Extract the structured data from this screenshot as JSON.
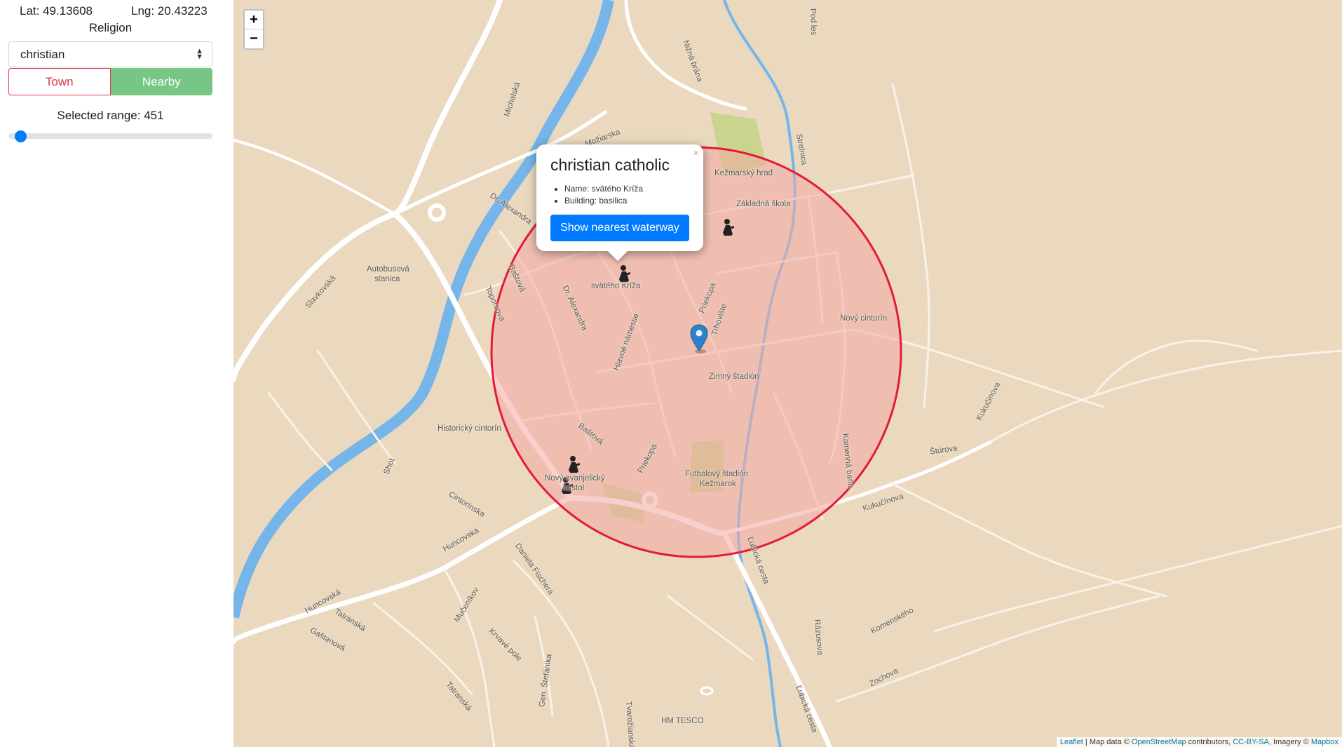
{
  "sidebar": {
    "lat_label": "Lat: 49.13608",
    "lng_label": "Lng: 20.43223",
    "title": "Religion",
    "select_value": "christian",
    "buttons": {
      "town": "Town",
      "nearby": "Nearby"
    },
    "range_label": "Selected range: 451",
    "range_fraction": 0.06
  },
  "map": {
    "zoom_in": "+",
    "zoom_out": "−",
    "labels": {
      "kezmarsky_hrad": "Kežmarský hrad",
      "zakladna_skola": "Základná škola",
      "novy_cintorin": "Nový cintorín",
      "zimny_stadion": "Zimný štadión",
      "futbalovy_stadion_1": "Futbalový štadión",
      "futbalovy_stadion_2": "Kežmarok",
      "historicky_cintorin": "Historický cintorín",
      "autobusova_1": "Autobusová",
      "autobusova_2": "stanica",
      "svateho_kriza": "svätého Kríža",
      "novy_kostol_1": "Nový evanjelický",
      "novy_kostol_2": "kostol",
      "hm_tesco": "HM TESCO"
    },
    "streets": {
      "michalska": "Michalská",
      "moziarska": "Možiarska",
      "dr_alexandra_1": "Dr. Alexandra",
      "dr_alexandra_2": "Dr. Alexandra",
      "slavkovska": "Slavkovská",
      "bastova_1": "Baštová",
      "bastova_2": "Baštová",
      "toporcova": "Toporcova",
      "hlavne_namestie": "Hlavné námestie",
      "priekopa_1": "Priekopa",
      "priekopa_2": "Priekopa",
      "trhoviste": "Trhovište",
      "nizna_brana": "Nižná brána",
      "strelnica": "Strelnica",
      "pod_les": "Pod les",
      "kamenna_bana": "Kamenná baňa",
      "sturova": "Štúrova",
      "kukucinova_1": "Kukučínova",
      "kukucinova_2": "Kukučínova",
      "lubicka_cesta_1": "Ľubická cesta",
      "lubicka_cesta_2": "Ľubická cesta",
      "razusova": "Rázusova",
      "komenskeho": "Komenského",
      "zochova": "Zochova",
      "cintorinska": "Cintorínska",
      "shot": "Shot",
      "huncovska_1": "Huncovská",
      "huncovska_2": "Huncovská",
      "tatranska_1": "Tatranská",
      "tatranska_2": "Tatranská",
      "gastanova": "Gaštanová",
      "mucenikov": "Mučeníkov",
      "krvave_pole": "Krvavé pole",
      "daniela_fischera": "Daniela Fischera",
      "gen_stefanika": "Gen. Štefánika",
      "tvarozianska": "Tvarožianska"
    },
    "popup": {
      "title": "christian catholic",
      "items": [
        "Name: svätého Kríža",
        "Building: basilica"
      ],
      "button": "Show nearest waterway",
      "close": "×"
    },
    "attribution": {
      "leaflet": "Leaflet",
      "text1": " | Map data © ",
      "osm": "OpenStreetMap",
      "text2": " contributors, ",
      "license": "CC-BY-SA",
      "text3": ", Imagery © ",
      "mapbox": "Mapbox"
    },
    "colors": {
      "land": "#ead9bf",
      "water": "#75b5ea",
      "park": "#cbd48e",
      "circle_stroke": "#e4193a",
      "circle_fill": "#f3a8a4",
      "marker": "#2a82cb"
    }
  }
}
